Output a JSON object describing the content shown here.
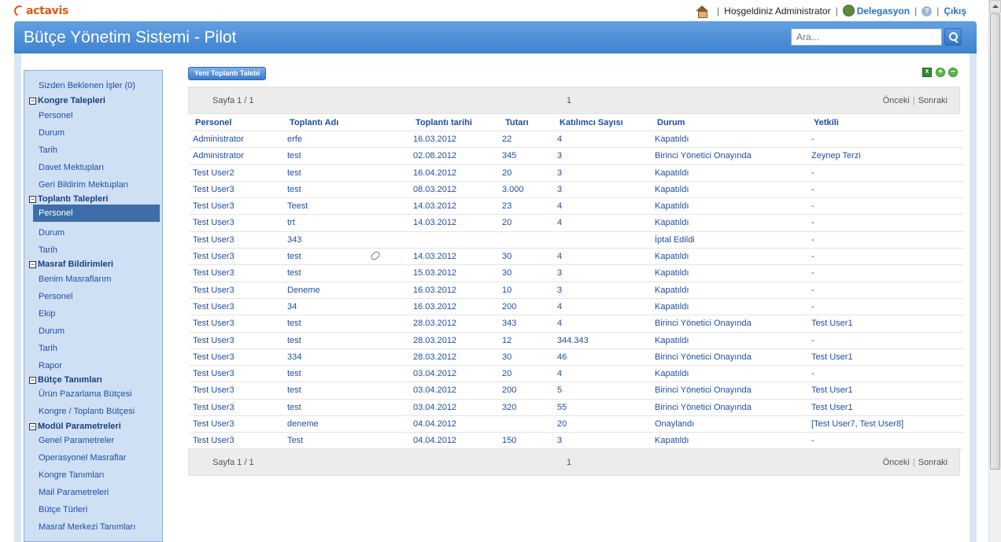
{
  "topbar": {
    "logo": "actavis",
    "welcome": "Hoşgeldiniz Administrator",
    "delegation": "Delegasyon",
    "logout": "Çıkış"
  },
  "header": {
    "title": "Bütçe Yönetim Sistemi - Pilot",
    "search_placeholder": "Ara..."
  },
  "sidebar": {
    "pending": "Sizden Beklenen İşler (0)",
    "groups": [
      {
        "title": "Kongre Talepleri",
        "items": [
          "Personel",
          "Durum",
          "Tarih",
          "Davet Mektupları",
          "Geri Bildirim Mektupları"
        ]
      },
      {
        "title": "Toplantı Talepleri",
        "items": [
          "Personel",
          "Durum",
          "Tarih"
        ]
      },
      {
        "title": "Masraf Bildirimleri",
        "items": [
          "Benim Masraflarım",
          "Personel",
          "Ekip",
          "Durum",
          "Tarih",
          "Rapor"
        ]
      },
      {
        "title": "Bütçe Tanımları",
        "items": [
          "Ürün Pazarlama Bütçesi",
          "Kongre / Toplantı Bütçesi"
        ]
      },
      {
        "title": "Modül Parametreleri",
        "items": [
          "Genel Parametreler",
          "Operasyonel Masraflar",
          "Kongre Tanımları",
          "Mail Parametreleri",
          "Bütçe Türleri",
          "Masraf Merkezi Tanımları"
        ]
      }
    ]
  },
  "toolbar": {
    "new_request": "Yeni Toplantı Talebi"
  },
  "pager": {
    "page_info": "Sayfa 1 / 1",
    "page_number": "1",
    "prev": "Önceki",
    "next": "Sonraki"
  },
  "table": {
    "columns": [
      "Personel",
      "Toplantı Adı",
      "Toplantı tarihi",
      "Tutarı",
      "Katılımcı Sayısı",
      "Durum",
      "Yetkili"
    ],
    "rows": [
      [
        "Administrator",
        "erfe",
        "16.03.2012",
        "22",
        "4",
        "Kapatıldı",
        "-"
      ],
      [
        "Administrator",
        "test",
        "02.08.2012",
        "345",
        "3",
        "Birinci Yönetici Onayında",
        "Zeynep Terzi"
      ],
      [
        "Test User2",
        "test",
        "16.04.2012",
        "20",
        "3",
        "Kapatıldı",
        "-"
      ],
      [
        "Test User3",
        "test",
        "08.03.2012",
        "3.000",
        "3",
        "Kapatıldı",
        "-"
      ],
      [
        "Test User3",
        "Teest",
        "14.03.2012",
        "23",
        "4",
        "Kapatıldı",
        "-"
      ],
      [
        "Test User3",
        "trt",
        "14.03.2012",
        "20",
        "4",
        "Kapatıldı",
        "-"
      ],
      [
        "Test User3",
        "343",
        "",
        "",
        "",
        "İptal Edildi",
        "-"
      ],
      [
        "Test User3",
        "test",
        "14.03.2012",
        "30",
        "4",
        "Kapatıldı",
        "-"
      ],
      [
        "Test User3",
        "test",
        "15.03.2012",
        "30",
        "3",
        "Kapatıldı",
        "-"
      ],
      [
        "Test User3",
        "Deneme",
        "16.03.2012",
        "10",
        "3",
        "Kapatıldı",
        "-"
      ],
      [
        "Test User3",
        "34",
        "16.03.2012",
        "200",
        "4",
        "Kapatıldı",
        "-"
      ],
      [
        "Test User3",
        "test",
        "28.03.2012",
        "343",
        "4",
        "Birinci Yönetici Onayında",
        "Test User1"
      ],
      [
        "Test User3",
        "test",
        "28.03.2012",
        "12",
        "344.343",
        "Kapatıldı",
        "-"
      ],
      [
        "Test User3",
        "334",
        "28.03.2012",
        "30",
        "46",
        "Birinci Yönetici Onayında",
        "Test User1"
      ],
      [
        "Test User3",
        "test",
        "03.04.2012",
        "20",
        "4",
        "Kapatıldı",
        "-"
      ],
      [
        "Test User3",
        "test",
        "03.04.2012",
        "200",
        "5",
        "Birinci Yönetici Onayında",
        "Test User1"
      ],
      [
        "Test User3",
        "test",
        "03.04.2012",
        "320",
        "55",
        "Birinci Yönetici Onayında",
        "Test User1"
      ],
      [
        "Test User3",
        "deneme",
        "04.04.2012",
        "",
        "20",
        "Onaylandı",
        "[Test User7, Test User8]"
      ],
      [
        "Test User3",
        "Test",
        "04.04.2012",
        "150",
        "3",
        "Kapatıldı",
        "-"
      ]
    ]
  }
}
